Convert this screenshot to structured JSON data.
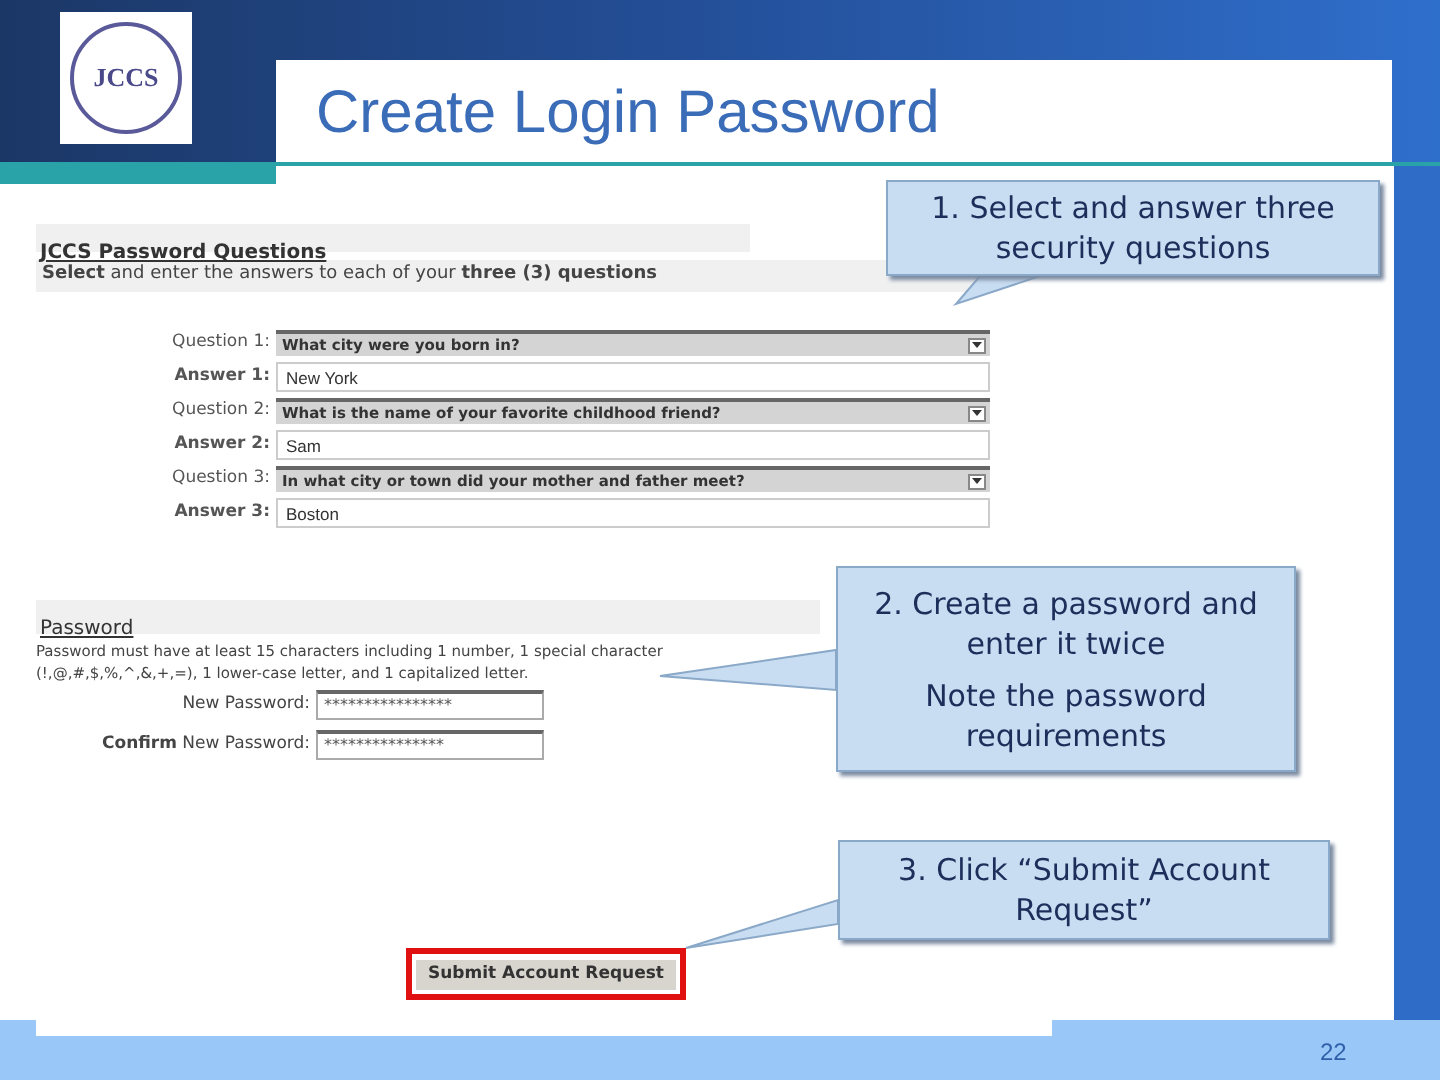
{
  "slide": {
    "title": "Create Login Password",
    "logo_text": "JCCS",
    "page_number": "22"
  },
  "questions_section": {
    "heading": "JCCS Password Questions",
    "instructions": "**Select** and enter the answers to each of your **three (3) questions**",
    "rows": [
      {
        "question_label": "Question 1:",
        "question": "What city were you born in?",
        "answer_label": "Answer 1:",
        "answer": "New York"
      },
      {
        "question_label": "Question 2:",
        "question": "What is the name of your favorite childhood friend?",
        "answer_label": "Answer 2:",
        "answer": "Sam"
      },
      {
        "question_label": "Question 3:",
        "question": "In what city or town did your mother and father meet?",
        "answer_label": "Answer 3:",
        "answer": "Boston"
      }
    ]
  },
  "password_section": {
    "heading": "Password",
    "requirements": "Password must have at least 15 characters including 1 number, 1 special character (!,@,#,$,%,^,&,+,=), 1 lower-case letter, and 1 capitalized letter.",
    "fields": [
      {
        "label": "New Password:",
        "value": "****************"
      },
      {
        "label": "**Confirm** New Password:",
        "value": "***************"
      }
    ]
  },
  "submit_button": {
    "label": "Submit Account Request",
    "highlighted": true
  },
  "callouts": [
    {
      "paragraphs": [
        "1. Select and answer three security questions"
      ]
    },
    {
      "paragraphs": [
        "2. Create a password and enter it twice",
        "Note the password requirements"
      ]
    },
    {
      "paragraphs": [
        "3. Click “Submit Account Request”"
      ]
    }
  ]
}
